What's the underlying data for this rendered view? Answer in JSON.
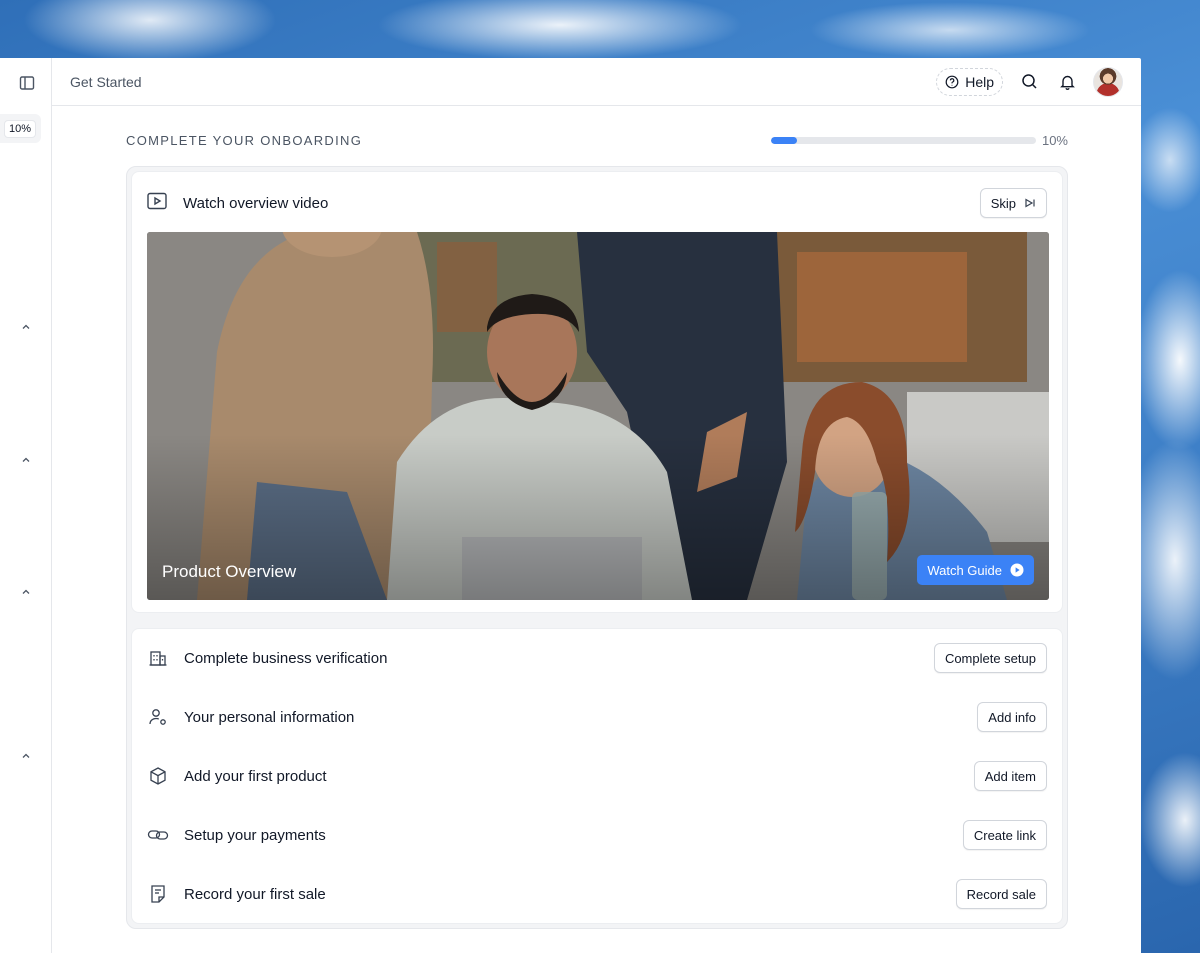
{
  "header": {
    "breadcrumb": "Get Started",
    "help_label": "Help",
    "icons": [
      "sidebar-toggle-icon",
      "help-circle-icon",
      "search-icon",
      "bell-icon"
    ]
  },
  "sidebar": {
    "progress_badge": "10%"
  },
  "onboarding": {
    "title": "COMPLETE YOUR ONBOARDING",
    "progress_percent": 10,
    "progress_label": "10%"
  },
  "video": {
    "title": "Watch overview video",
    "skip_label": "Skip",
    "overlay_title": "Product Overview",
    "watch_label": "Watch Guide"
  },
  "tasks": [
    {
      "label": "Complete business verification",
      "button": "Complete setup",
      "icon": "building-icon"
    },
    {
      "label": "Your personal information",
      "button": "Add info",
      "icon": "user-settings-icon"
    },
    {
      "label": "Add your first product",
      "button": "Add item",
      "icon": "box-icon"
    },
    {
      "label": "Setup your payments",
      "button": "Create link",
      "icon": "link-icon"
    },
    {
      "label": "Record your first sale",
      "button": "Record sale",
      "icon": "receipt-icon"
    }
  ],
  "colors": {
    "accent": "#3b82f6",
    "progress_track": "#e5e7eb",
    "text": "#111827"
  }
}
